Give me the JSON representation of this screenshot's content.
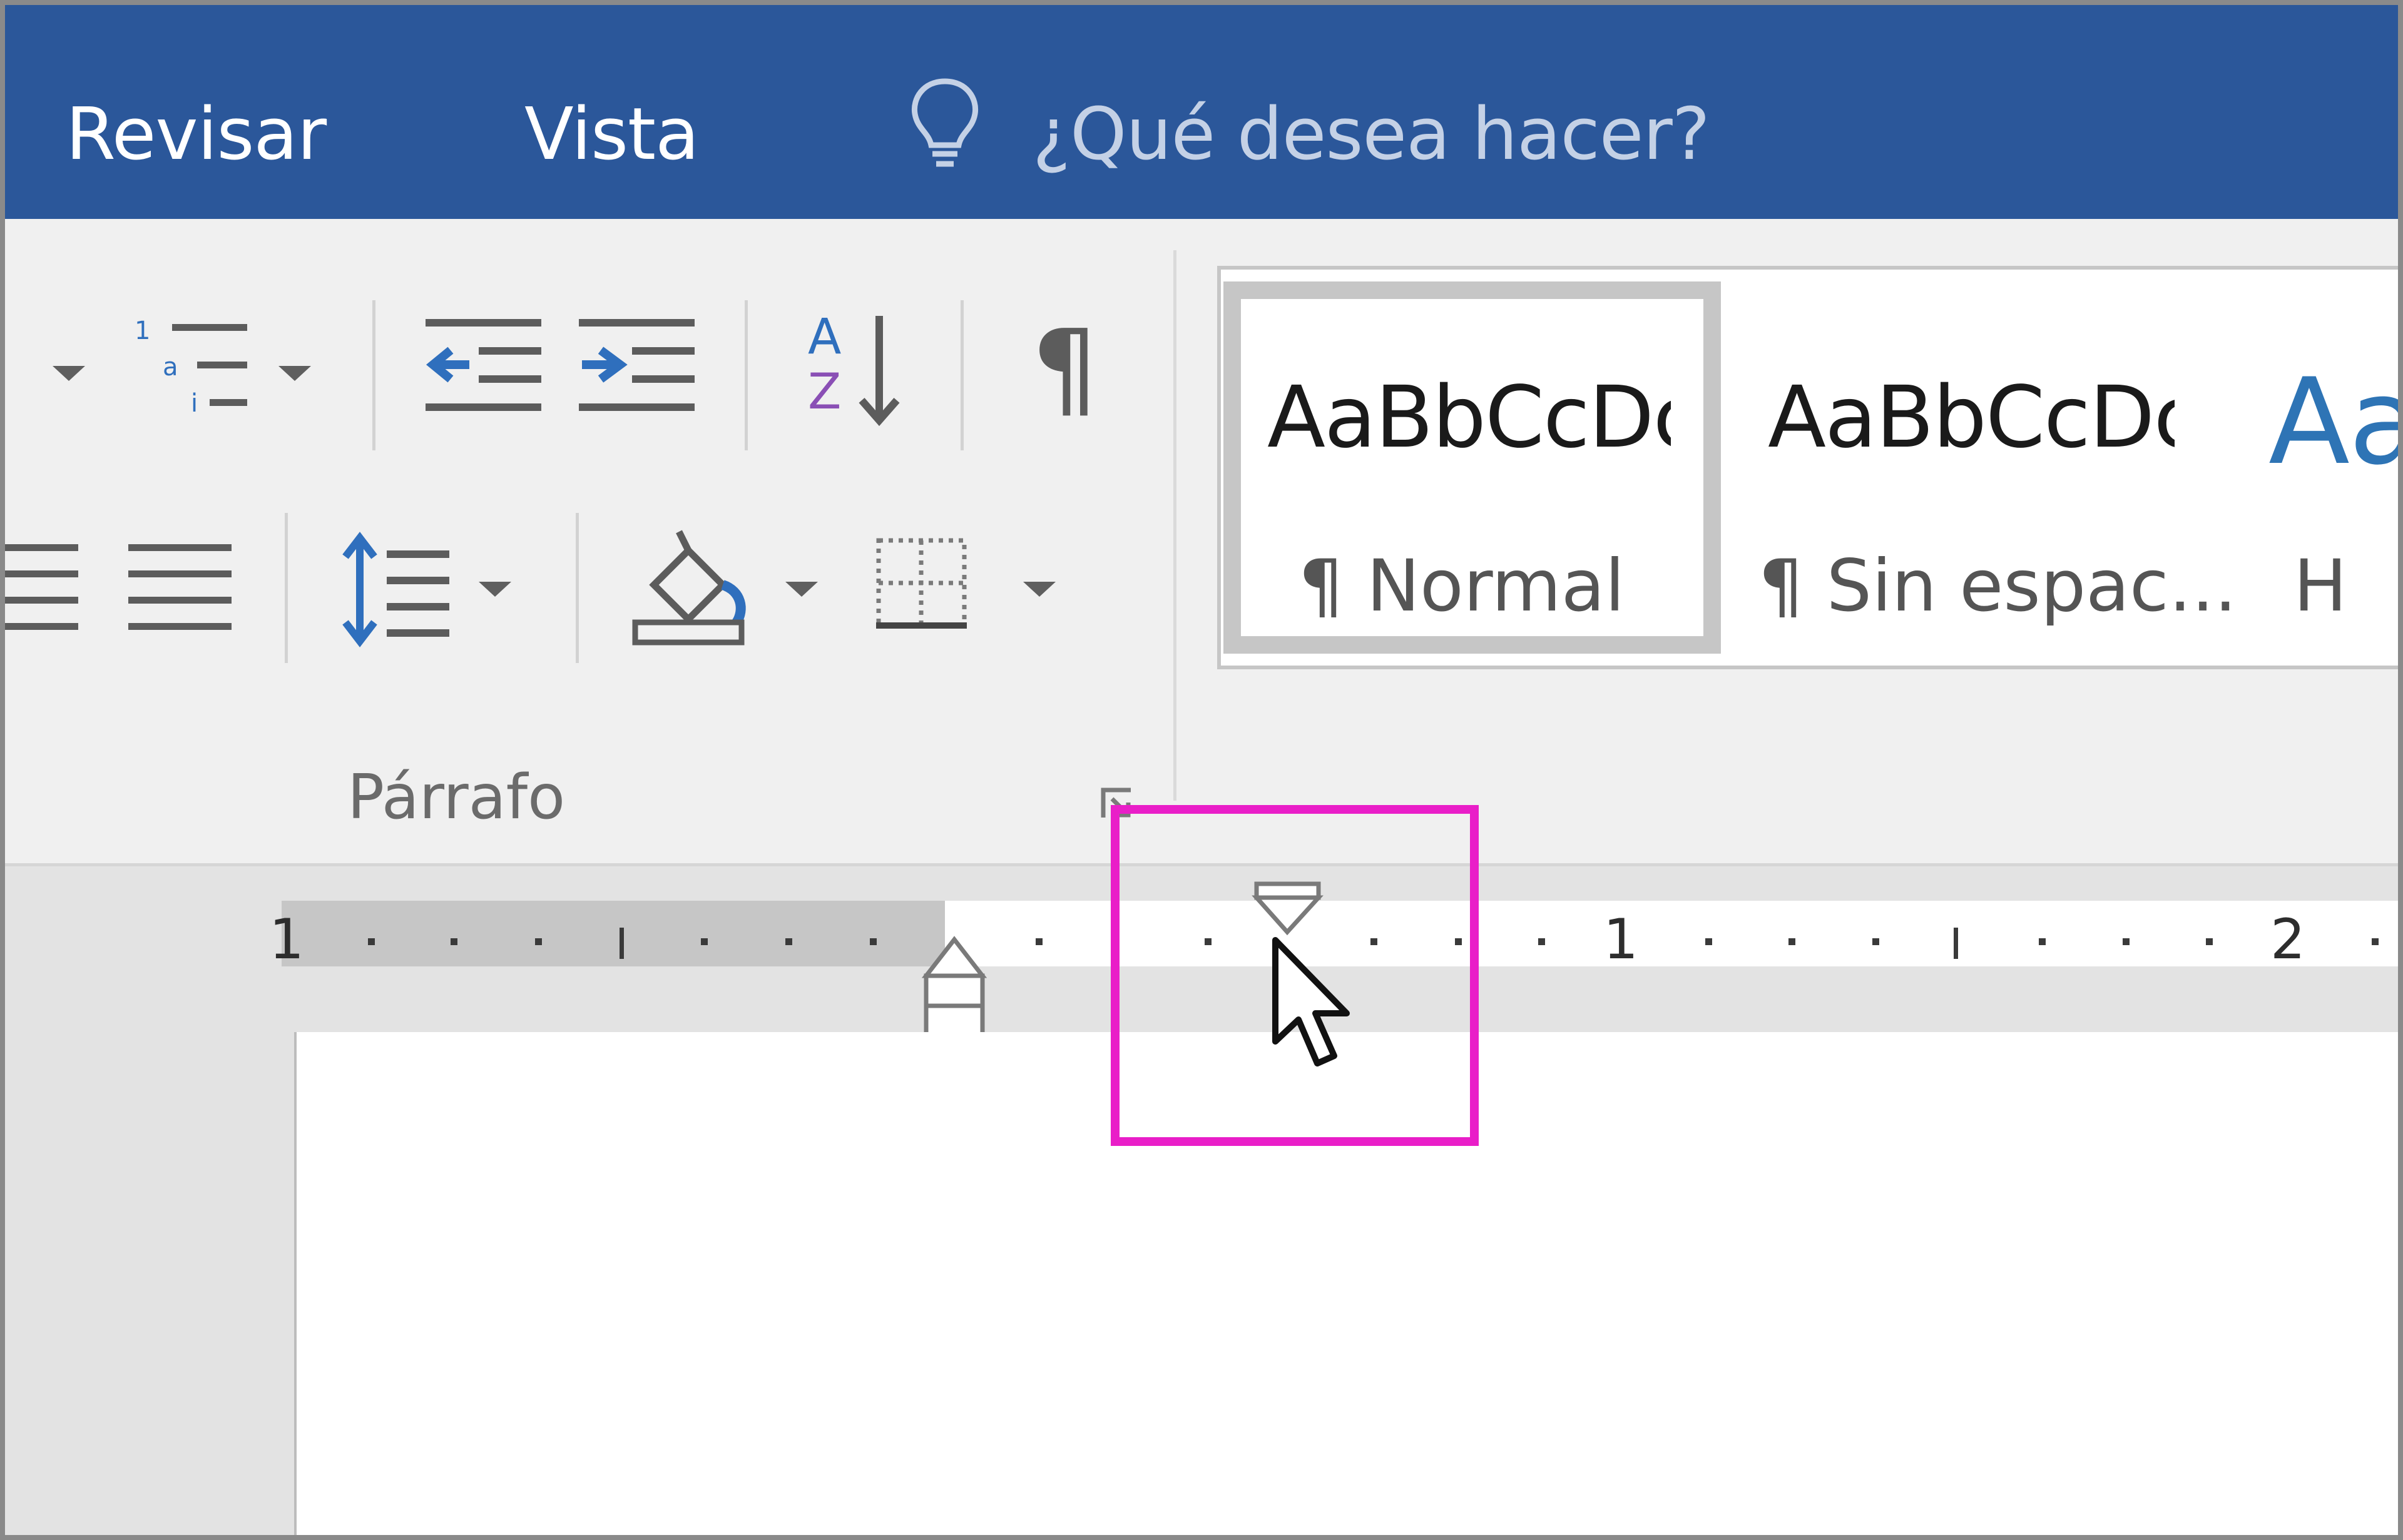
{
  "tabs": [
    {
      "label": "Revisar"
    },
    {
      "label": "Vista"
    }
  ],
  "tell_me": {
    "placeholder": "¿Qué desea hacer?",
    "icon": "lightbulb-icon"
  },
  "paragraph_group": {
    "label": "Párrafo",
    "icons": [
      "multilevel-list-icon",
      "decrease-indent-icon",
      "increase-indent-icon",
      "sort-icon",
      "pilcrow-icon",
      "align-right-icon",
      "justify-icon",
      "line-spacing-icon",
      "shading-icon",
      "borders-icon",
      "dialog-launcher-icon"
    ]
  },
  "sort_letters": {
    "a": "A",
    "z": "Z"
  },
  "pilcrow": "¶",
  "styles": [
    {
      "sample": "AaBbCcDc",
      "name": "¶ Normal",
      "selected": true
    },
    {
      "sample": "AaBbCcDc",
      "name": "¶ Sin espac..."
    },
    {
      "sample": "Aa",
      "name": "H"
    }
  ],
  "ruler": {
    "numbers": [
      "1",
      "1",
      "2"
    ]
  },
  "colors": {
    "tabbar": "#2b579a",
    "highlight": "#e91ec8",
    "heading_sample": "#2e74b5"
  }
}
